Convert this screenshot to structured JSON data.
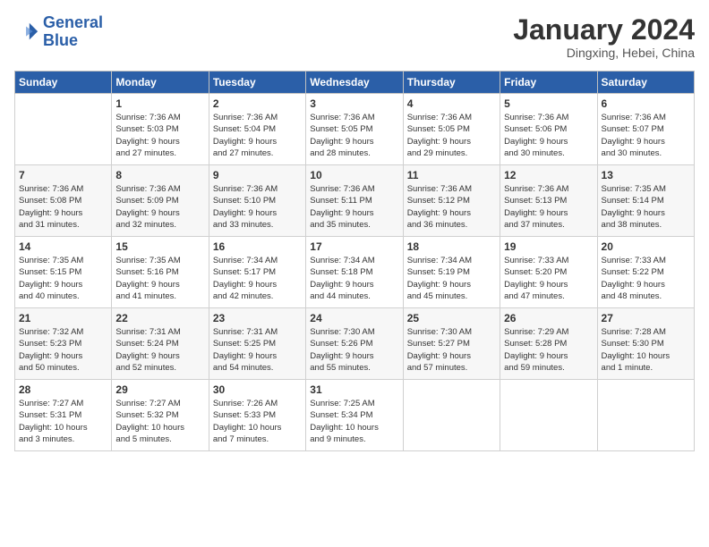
{
  "logo": {
    "line1": "General",
    "line2": "Blue"
  },
  "header": {
    "month": "January 2024",
    "location": "Dingxing, Hebei, China"
  },
  "columns": [
    "Sunday",
    "Monday",
    "Tuesday",
    "Wednesday",
    "Thursday",
    "Friday",
    "Saturday"
  ],
  "weeks": [
    [
      {
        "day": "",
        "info": ""
      },
      {
        "day": "1",
        "info": "Sunrise: 7:36 AM\nSunset: 5:03 PM\nDaylight: 9 hours\nand 27 minutes."
      },
      {
        "day": "2",
        "info": "Sunrise: 7:36 AM\nSunset: 5:04 PM\nDaylight: 9 hours\nand 27 minutes."
      },
      {
        "day": "3",
        "info": "Sunrise: 7:36 AM\nSunset: 5:05 PM\nDaylight: 9 hours\nand 28 minutes."
      },
      {
        "day": "4",
        "info": "Sunrise: 7:36 AM\nSunset: 5:05 PM\nDaylight: 9 hours\nand 29 minutes."
      },
      {
        "day": "5",
        "info": "Sunrise: 7:36 AM\nSunset: 5:06 PM\nDaylight: 9 hours\nand 30 minutes."
      },
      {
        "day": "6",
        "info": "Sunrise: 7:36 AM\nSunset: 5:07 PM\nDaylight: 9 hours\nand 30 minutes."
      }
    ],
    [
      {
        "day": "7",
        "info": "Sunrise: 7:36 AM\nSunset: 5:08 PM\nDaylight: 9 hours\nand 31 minutes."
      },
      {
        "day": "8",
        "info": "Sunrise: 7:36 AM\nSunset: 5:09 PM\nDaylight: 9 hours\nand 32 minutes."
      },
      {
        "day": "9",
        "info": "Sunrise: 7:36 AM\nSunset: 5:10 PM\nDaylight: 9 hours\nand 33 minutes."
      },
      {
        "day": "10",
        "info": "Sunrise: 7:36 AM\nSunset: 5:11 PM\nDaylight: 9 hours\nand 35 minutes."
      },
      {
        "day": "11",
        "info": "Sunrise: 7:36 AM\nSunset: 5:12 PM\nDaylight: 9 hours\nand 36 minutes."
      },
      {
        "day": "12",
        "info": "Sunrise: 7:36 AM\nSunset: 5:13 PM\nDaylight: 9 hours\nand 37 minutes."
      },
      {
        "day": "13",
        "info": "Sunrise: 7:35 AM\nSunset: 5:14 PM\nDaylight: 9 hours\nand 38 minutes."
      }
    ],
    [
      {
        "day": "14",
        "info": "Sunrise: 7:35 AM\nSunset: 5:15 PM\nDaylight: 9 hours\nand 40 minutes."
      },
      {
        "day": "15",
        "info": "Sunrise: 7:35 AM\nSunset: 5:16 PM\nDaylight: 9 hours\nand 41 minutes."
      },
      {
        "day": "16",
        "info": "Sunrise: 7:34 AM\nSunset: 5:17 PM\nDaylight: 9 hours\nand 42 minutes."
      },
      {
        "day": "17",
        "info": "Sunrise: 7:34 AM\nSunset: 5:18 PM\nDaylight: 9 hours\nand 44 minutes."
      },
      {
        "day": "18",
        "info": "Sunrise: 7:34 AM\nSunset: 5:19 PM\nDaylight: 9 hours\nand 45 minutes."
      },
      {
        "day": "19",
        "info": "Sunrise: 7:33 AM\nSunset: 5:20 PM\nDaylight: 9 hours\nand 47 minutes."
      },
      {
        "day": "20",
        "info": "Sunrise: 7:33 AM\nSunset: 5:22 PM\nDaylight: 9 hours\nand 48 minutes."
      }
    ],
    [
      {
        "day": "21",
        "info": "Sunrise: 7:32 AM\nSunset: 5:23 PM\nDaylight: 9 hours\nand 50 minutes."
      },
      {
        "day": "22",
        "info": "Sunrise: 7:31 AM\nSunset: 5:24 PM\nDaylight: 9 hours\nand 52 minutes."
      },
      {
        "day": "23",
        "info": "Sunrise: 7:31 AM\nSunset: 5:25 PM\nDaylight: 9 hours\nand 54 minutes."
      },
      {
        "day": "24",
        "info": "Sunrise: 7:30 AM\nSunset: 5:26 PM\nDaylight: 9 hours\nand 55 minutes."
      },
      {
        "day": "25",
        "info": "Sunrise: 7:30 AM\nSunset: 5:27 PM\nDaylight: 9 hours\nand 57 minutes."
      },
      {
        "day": "26",
        "info": "Sunrise: 7:29 AM\nSunset: 5:28 PM\nDaylight: 9 hours\nand 59 minutes."
      },
      {
        "day": "27",
        "info": "Sunrise: 7:28 AM\nSunset: 5:30 PM\nDaylight: 10 hours\nand 1 minute."
      }
    ],
    [
      {
        "day": "28",
        "info": "Sunrise: 7:27 AM\nSunset: 5:31 PM\nDaylight: 10 hours\nand 3 minutes."
      },
      {
        "day": "29",
        "info": "Sunrise: 7:27 AM\nSunset: 5:32 PM\nDaylight: 10 hours\nand 5 minutes."
      },
      {
        "day": "30",
        "info": "Sunrise: 7:26 AM\nSunset: 5:33 PM\nDaylight: 10 hours\nand 7 minutes."
      },
      {
        "day": "31",
        "info": "Sunrise: 7:25 AM\nSunset: 5:34 PM\nDaylight: 10 hours\nand 9 minutes."
      },
      {
        "day": "",
        "info": ""
      },
      {
        "day": "",
        "info": ""
      },
      {
        "day": "",
        "info": ""
      }
    ]
  ]
}
